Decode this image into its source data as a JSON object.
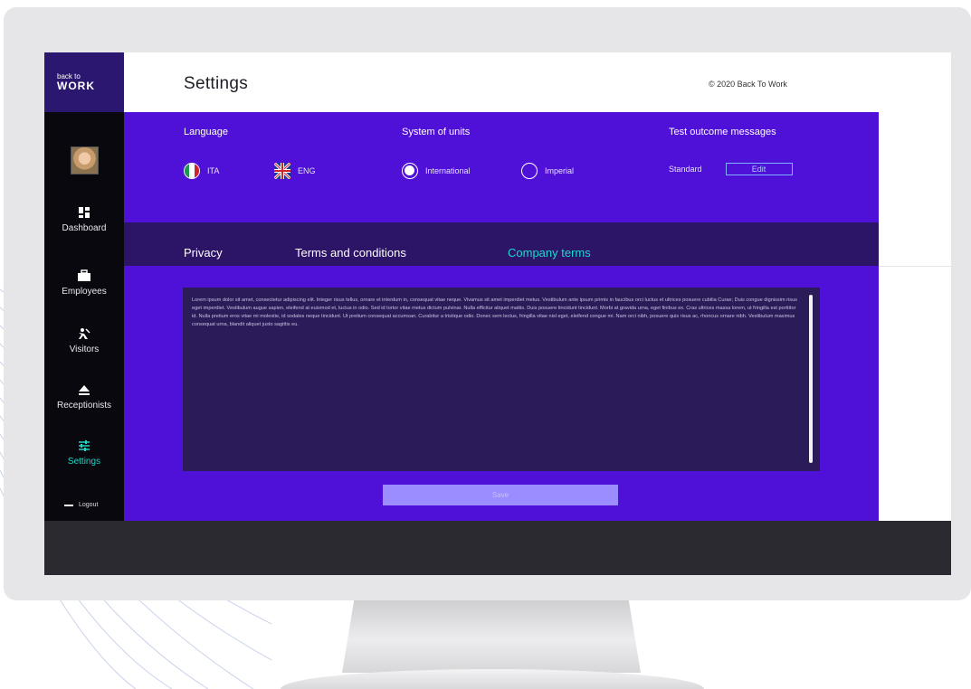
{
  "brand": {
    "line1": "back to",
    "line2": "WORK"
  },
  "header": {
    "title": "Settings",
    "copyright": "© 2020 Back To Work"
  },
  "sidebar": {
    "items": [
      {
        "label": "Dashboard",
        "icon": "dashboard-icon"
      },
      {
        "label": "Employees",
        "icon": "briefcase-icon"
      },
      {
        "label": "Visitors",
        "icon": "visitor-icon"
      },
      {
        "label": "Receptionists",
        "icon": "eject-icon"
      },
      {
        "label": "Settings",
        "icon": "sliders-icon",
        "active": true
      }
    ],
    "logout_label": "Logout"
  },
  "settings": {
    "language": {
      "title": "Language",
      "options": [
        {
          "label": "ITA",
          "selected": true
        },
        {
          "label": "ENG",
          "selected": false
        }
      ]
    },
    "units": {
      "title": "System of units",
      "options": [
        {
          "label": "International",
          "selected": true
        },
        {
          "label": "Imperial",
          "selected": false
        }
      ]
    },
    "test_outcome": {
      "title": "Test outcome messages",
      "value": "Standard",
      "edit_label": "Edit"
    }
  },
  "tabs": [
    {
      "label": "Privacy",
      "active": false
    },
    {
      "label": "Terms and conditions",
      "active": false
    },
    {
      "label": "Company terms",
      "active": true
    }
  ],
  "company_terms_text": "Lorem ipsum dolor sit amet, consectetur adipiscing elit. Integer risus tellus, ornare et interdum in, consequat vitae neque. Vivamus sit amet imperdiet metus. Vestibulum ante ipsum primis in faucibus orci luctus et ultrices posuere cubilia Curae; Duis congue dignissim risus eget imperdiet. Vestibulum augue sapien, eleifend at euismod et, luctus in odio. Sed id tortor vitae metus dictum pulvinar. Nulla efficitur aliquet mattis. Duis posuere tincidunt tincidunt. Morbi at gravida urna, eget finibus ex. Cras ultrices massa lorem, ut fringilla est porttitor id. Nulla pretium eros vitae mi molestie, id sodales neque tincidunt. Ut pretium consequat accumsan. Curabitur a tristique odio. Donec sem lectus, fringilla vitae nisl eget, eleifend congue mi. Nam orci nibh, posuere quis risus ac, rhoncus ornare nibh. Vestibulum maximus consequat urna, blandit aliquet justo sagittis eu.",
  "save_label": "Save",
  "colors": {
    "primary": "#4f10d8",
    "tabbar": "#2c1466",
    "accent": "#1ed8d0",
    "sidebar": "#09080f",
    "save": "#9b8cff"
  }
}
